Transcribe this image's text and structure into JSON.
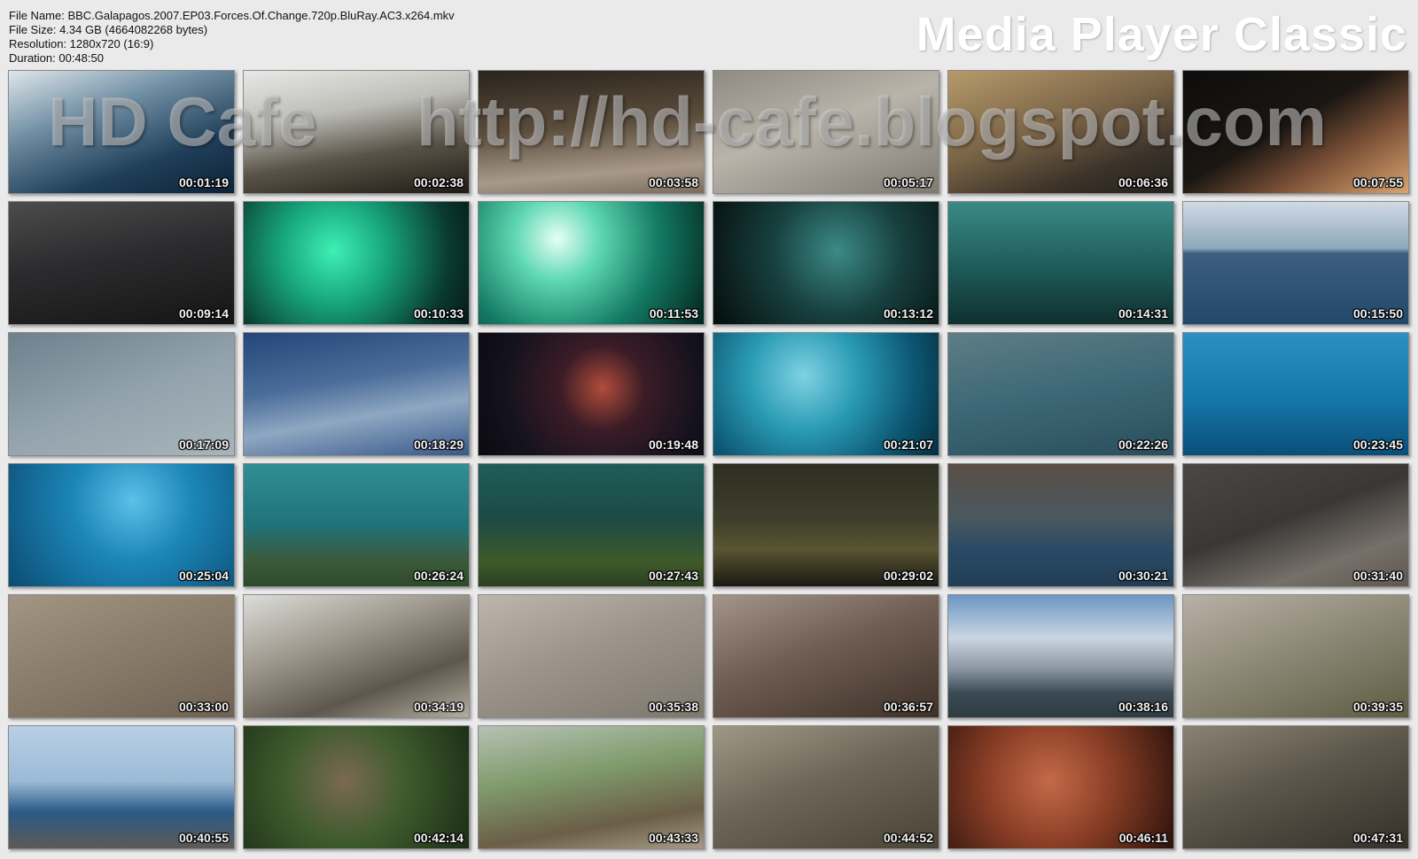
{
  "info": {
    "file_name": "File Name: BBC.Galapagos.2007.EP03.Forces.Of.Change.720p.BluRay.AC3.x264.mkv",
    "file_size": "File Size: 4.34 GB (4664082268 bytes)",
    "resolution": "Resolution: 1280x720 (16:9)",
    "duration": "Duration: 00:48:50"
  },
  "brand": "Media Player Classic",
  "watermark": {
    "left": "HD Cafe",
    "right": "http://hd-cafe.blogspot.com"
  },
  "thumbnails": [
    {
      "time": "00:01:19",
      "bg": "linear-gradient(160deg,#dfe6ea 0%,#6f8ea3 35%,#203f5a 70%,#0d2236 100%)"
    },
    {
      "time": "00:02:38",
      "bg": "linear-gradient(170deg,#e8e8e6 0%,#bdbdb8 35%,#5a5448 65%,#1f1a14 100%)"
    },
    {
      "time": "00:03:58",
      "bg": "linear-gradient(175deg,#2a241d 0%,#5b4d3c 45%,#a8998a 80%,#7a6c5c 100%)"
    },
    {
      "time": "00:05:17",
      "bg": "linear-gradient(160deg,#8f8a82 0%,#b9b4aa 45%,#7e7a72 100%)"
    },
    {
      "time": "00:06:36",
      "bg": "linear-gradient(160deg,#b79a6b 0%,#7a6447 45%,#3d342a 75%,#22201c 100%)"
    },
    {
      "time": "00:07:55",
      "bg": "linear-gradient(150deg,#0e0d0c 0%,#1a1612 45%,#7d5238 70%,#d9a46f 100%)"
    },
    {
      "time": "00:09:14",
      "bg": "linear-gradient(170deg,#4c4c4d 0%,#2c2c2e 45%,#151516 100%)"
    },
    {
      "time": "00:10:33",
      "bg": "radial-gradient(circle at 40% 40%,#3ef0b4 0%,#17a47b 35%,#0a3a30 75%,#061a17 100%)"
    },
    {
      "time": "00:11:53",
      "bg": "radial-gradient(circle at 35% 30%,#e6fff6 0%,#5fd8b2 25%,#137a63 60%,#04231d 100%)"
    },
    {
      "time": "00:13:12",
      "bg": "radial-gradient(circle at 55% 40%,#3c8a87 0%,#17403e 45%,#050c0c 100%)"
    },
    {
      "time": "00:14:31",
      "bg": "linear-gradient(180deg,#3a8a86 0%,#1d5a57 55%,#0f302f 100%)"
    },
    {
      "time": "00:15:50",
      "bg": "linear-gradient(180deg,#cfdae3 0%,#8fa7bd 38%,#3d5f80 42%,#22486a 100%)"
    },
    {
      "time": "00:17:09",
      "bg": "linear-gradient(160deg,#6d808c 0%,#92a2ac 50%,#a7b4bb 100%)"
    },
    {
      "time": "00:18:29",
      "bg": "linear-gradient(170deg,#24467a 0%,#4a6d99 40%,#8fa7c2 65%,#37598a 100%)"
    },
    {
      "time": "00:19:48",
      "bg": "radial-gradient(circle at 55% 45%,#b14d3a 0%,#3b1c26 30%,#14121e 70%,#0a0a10 100%)"
    },
    {
      "time": "00:21:07",
      "bg": "radial-gradient(circle at 40% 35%,#7fd2e2 0%,#2a9bb5 35%,#0d5874 70%,#062e3f 100%)"
    },
    {
      "time": "00:22:26",
      "bg": "linear-gradient(170deg,#5f7d86 0%,#3f6a77 45%,#2a4e5c 100%)"
    },
    {
      "time": "00:23:45",
      "bg": "linear-gradient(180deg,#2c8fc2 0%,#1577a9 55%,#0a4e78 100%)"
    },
    {
      "time": "00:25:04",
      "bg": "radial-gradient(circle at 55% 30%,#5cc0e8 0%,#1c86b8 40%,#0b4c72 100%)"
    },
    {
      "time": "00:26:24",
      "bg": "linear-gradient(180deg,#2f8f94 0%,#21727a 50%,#3b5a38 80%,#2e4a2b 100%)"
    },
    {
      "time": "00:27:43",
      "bg": "linear-gradient(180deg,#1f5c58 0%,#1d4a45 45%,#3f5a2a 80%,#2c3e1f 100%)"
    },
    {
      "time": "00:29:02",
      "bg": "linear-gradient(180deg,#2d2e22 0%,#3e3f2b 45%,#5a5431 70%,#1a1a14 100%)"
    },
    {
      "time": "00:30:21",
      "bg": "linear-gradient(180deg,#5a4e45 0%,#4a5860 45%,#2a4a66 70%,#213d55 100%)"
    },
    {
      "time": "00:31:40",
      "bg": "linear-gradient(160deg,#4a4846 0%,#3a3836 45%,#76706a 75%,#5e5850 100%)"
    },
    {
      "time": "00:33:00",
      "bg": "linear-gradient(160deg,#a39583 0%,#8c7d6b 45%,#6f6253 100%)"
    },
    {
      "time": "00:34:19",
      "bg": "linear-gradient(160deg,#dcdcd9 0%,#9a9488 40%,#5e574d 70%,#b3aca0 100%)"
    },
    {
      "time": "00:35:38",
      "bg": "linear-gradient(160deg,#bdb6ad 0%,#9c958a 45%,#7e776d 100%)"
    },
    {
      "time": "00:36:57",
      "bg": "linear-gradient(160deg,#a4948a 0%,#6f5d52 45%,#3e3129 100%)"
    },
    {
      "time": "00:38:16",
      "bg": "linear-gradient(180deg,#6b96c4 0%,#c9d6e2 35%,#8b98a4 60%,#3b4a55 80%,#2e3b42 100%)"
    },
    {
      "time": "00:39:35",
      "bg": "linear-gradient(160deg,#b9b0a6 0%,#8f8a78 45%,#5e5c44 100%)"
    },
    {
      "time": "00:40:55",
      "bg": "linear-gradient(180deg,#b7d0e6 0%,#9cbad6 45%,#2a5a86 70%,#5c5a55 100%)"
    },
    {
      "time": "00:42:14",
      "bg": "radial-gradient(circle at 45% 45%,#7a6a52 0%,#3d5a2c 45%,#1b2c16 100%)"
    },
    {
      "time": "00:43:33",
      "bg": "linear-gradient(170deg,#b5c2b4 0%,#7f9a6b 40%,#6b5e48 75%,#a59b87 100%)"
    },
    {
      "time": "00:44:52",
      "bg": "linear-gradient(160deg,#a09886 0%,#6e6658 45%,#4a4436 100%)"
    },
    {
      "time": "00:46:11",
      "bg": "radial-gradient(circle at 45% 45%,#c36a48 0%,#8a3e26 45%,#2a120c 100%)"
    },
    {
      "time": "00:47:31",
      "bg": "linear-gradient(160deg,#8a8274 0%,#5c564a 45%,#34302a 100%)"
    }
  ]
}
